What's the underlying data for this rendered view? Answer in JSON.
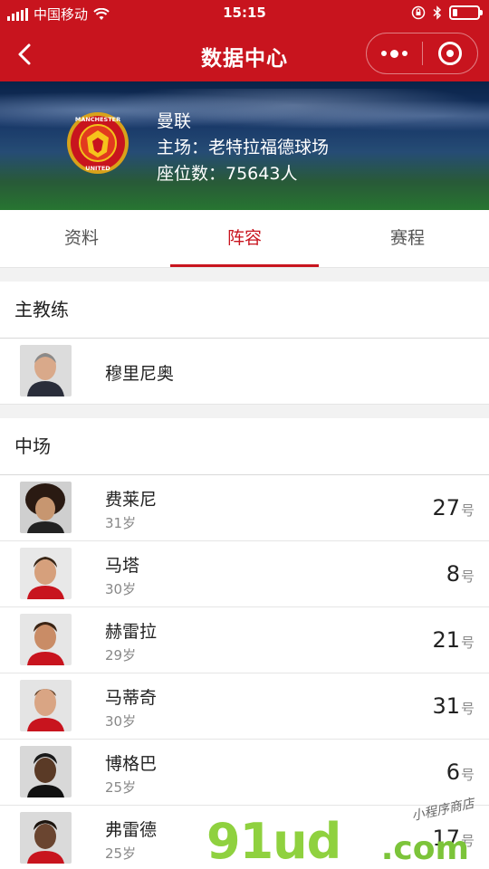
{
  "status_bar": {
    "carrier": "中国移动",
    "time": "15:15",
    "battery_level": 0.2
  },
  "nav": {
    "title": "数据中心",
    "icons": [
      "back-icon",
      "more-dots-icon",
      "close-target-icon"
    ]
  },
  "team": {
    "name": "曼联",
    "stadium": "主场：老特拉福德球场",
    "capacity": "座位数：75643人",
    "logo_text": [
      "MANCHESTER",
      "UNITED"
    ]
  },
  "tabs": [
    {
      "label": "资料",
      "active": false
    },
    {
      "label": "阵容",
      "active": true
    },
    {
      "label": "赛程",
      "active": false
    }
  ],
  "coach_section": {
    "title": "主教练",
    "coach": {
      "name": "穆里尼奥"
    }
  },
  "midfield_section": {
    "title": "中场",
    "players": [
      {
        "name": "费莱尼",
        "age": "31岁",
        "number": "27",
        "unit": "号"
      },
      {
        "name": "马塔",
        "age": "30岁",
        "number": "8",
        "unit": "号"
      },
      {
        "name": "赫雷拉",
        "age": "29岁",
        "number": "21",
        "unit": "号"
      },
      {
        "name": "马蒂奇",
        "age": "30岁",
        "number": "31",
        "unit": "号"
      },
      {
        "name": "博格巴",
        "age": "25岁",
        "number": "6",
        "unit": "号"
      },
      {
        "name": "弗雷德",
        "age": "25岁",
        "number": "17",
        "unit": "号"
      }
    ]
  },
  "watermark": {
    "main": "91ud",
    "com": ".com",
    "small": "小程序商店"
  },
  "colors": {
    "brand": "#c8141e",
    "watermark": "#8fd13f"
  }
}
